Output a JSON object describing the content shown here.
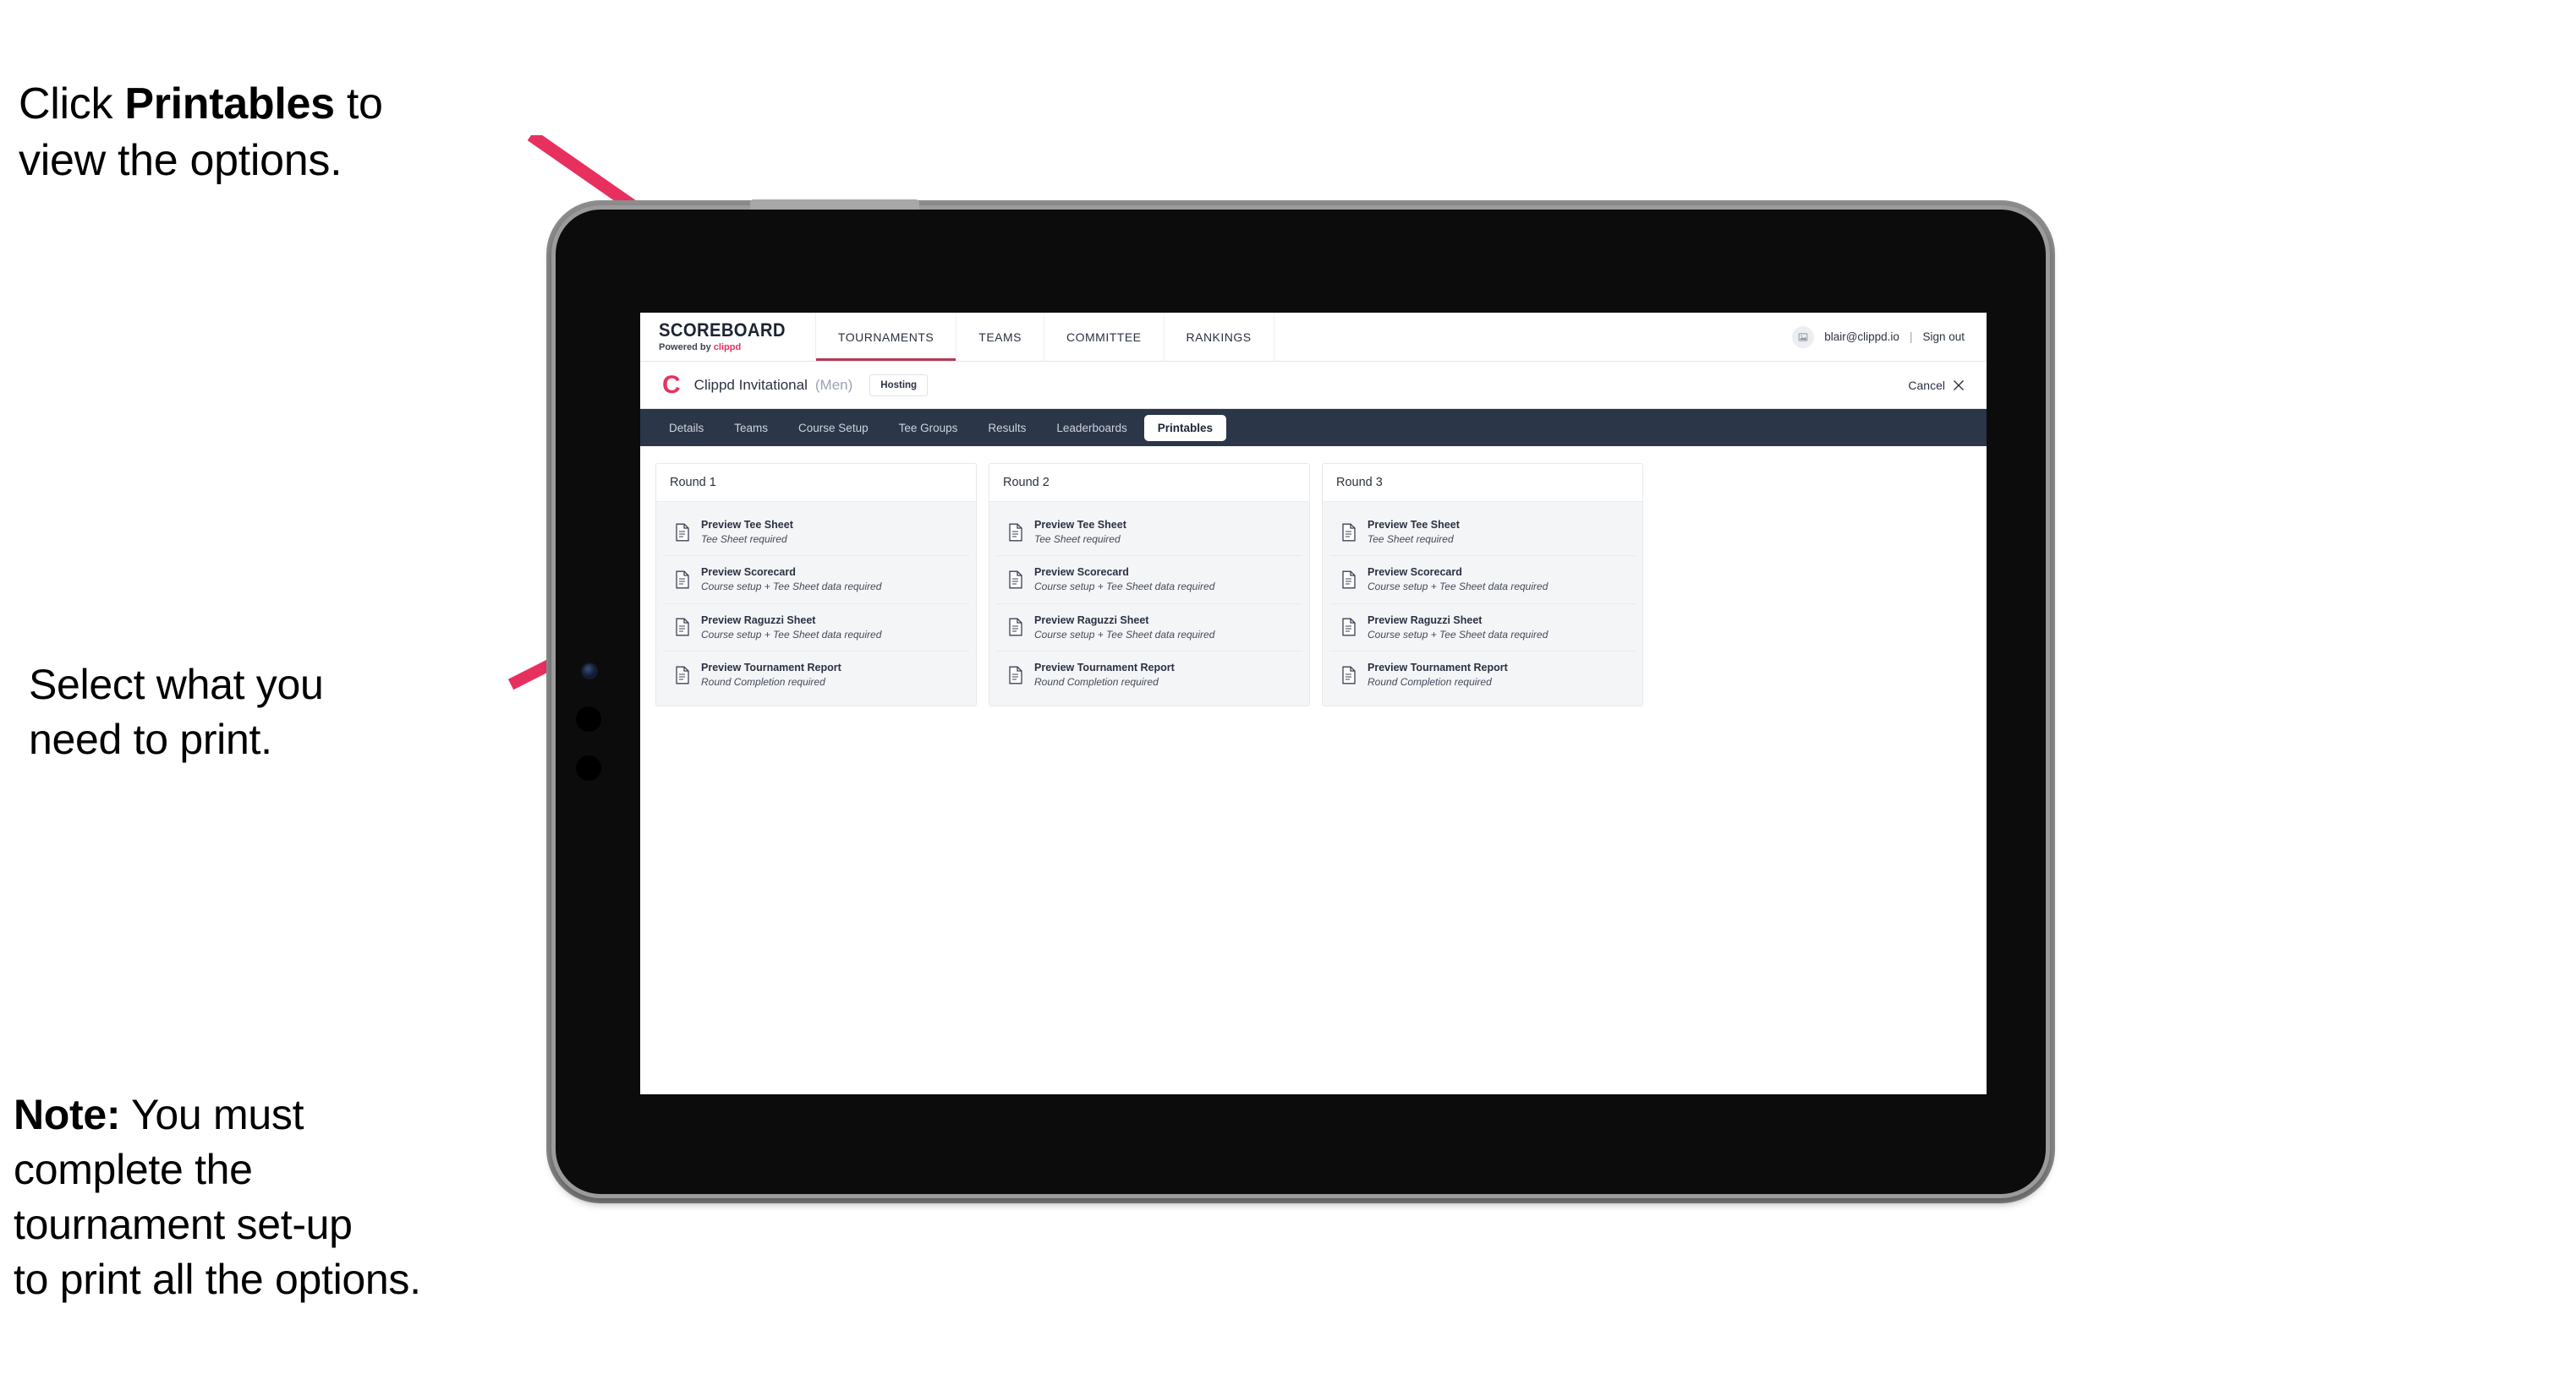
{
  "annotations": {
    "top": {
      "prefix": "Click ",
      "bold": "Printables",
      "suffix": " to\nview the options."
    },
    "middle": {
      "text": "Select what you\n need to print."
    },
    "note": {
      "prefix": "",
      "bold": "Note:",
      "suffix": " You must\ncomplete the\ntournament set-up\nto print all the options."
    }
  },
  "app": {
    "brand": {
      "wordmark": "SCOREBOARD",
      "powered_prefix": "Powered by ",
      "powered_brand": "clippd"
    },
    "topnav": [
      {
        "label": "TOURNAMENTS",
        "active": true
      },
      {
        "label": "TEAMS",
        "active": false
      },
      {
        "label": "COMMITTEE",
        "active": false
      },
      {
        "label": "RANKINGS",
        "active": false
      }
    ],
    "user": {
      "avatar_icon": "user-image-icon",
      "email": "blair@clippd.io",
      "separator": "|",
      "signout": "Sign out"
    },
    "title_bar": {
      "logo_letter": "C",
      "tournament_name": "Clippd Invitational",
      "gender": "(Men)",
      "hosting_badge": "Hosting",
      "cancel_label": "Cancel",
      "cancel_icon": "close-x-icon"
    },
    "section_tabs": [
      {
        "label": "Details",
        "active": false
      },
      {
        "label": "Teams",
        "active": false
      },
      {
        "label": "Course Setup",
        "active": false
      },
      {
        "label": "Tee Groups",
        "active": false
      },
      {
        "label": "Results",
        "active": false
      },
      {
        "label": "Leaderboards",
        "active": false
      },
      {
        "label": "Printables",
        "active": true
      }
    ],
    "rounds": [
      {
        "header": "Round 1",
        "items": [
          {
            "title": "Preview Tee Sheet",
            "requirement": "Tee Sheet required"
          },
          {
            "title": "Preview Scorecard",
            "requirement": "Course setup + Tee Sheet data required"
          },
          {
            "title": "Preview Raguzzi Sheet",
            "requirement": "Course setup + Tee Sheet data required"
          },
          {
            "title": "Preview Tournament Report",
            "requirement": "Round Completion required"
          }
        ]
      },
      {
        "header": "Round 2",
        "items": [
          {
            "title": "Preview Tee Sheet",
            "requirement": "Tee Sheet required"
          },
          {
            "title": "Preview Scorecard",
            "requirement": "Course setup + Tee Sheet data required"
          },
          {
            "title": "Preview Raguzzi Sheet",
            "requirement": "Course setup + Tee Sheet data required"
          },
          {
            "title": "Preview Tournament Report",
            "requirement": "Round Completion required"
          }
        ]
      },
      {
        "header": "Round 3",
        "items": [
          {
            "title": "Preview Tee Sheet",
            "requirement": "Tee Sheet required"
          },
          {
            "title": "Preview Scorecard",
            "requirement": "Course setup + Tee Sheet data required"
          },
          {
            "title": "Preview Raguzzi Sheet",
            "requirement": "Course setup + Tee Sheet data required"
          },
          {
            "title": "Preview Tournament Report",
            "requirement": "Round Completion required"
          }
        ]
      }
    ]
  },
  "colors": {
    "arrow_pink": "#e8305f",
    "brand_pink": "#e8305f",
    "tab_strip_dark": "#2b3649",
    "active_topnav_underline": "#b23a53",
    "item_background": "#f4f5f7"
  }
}
